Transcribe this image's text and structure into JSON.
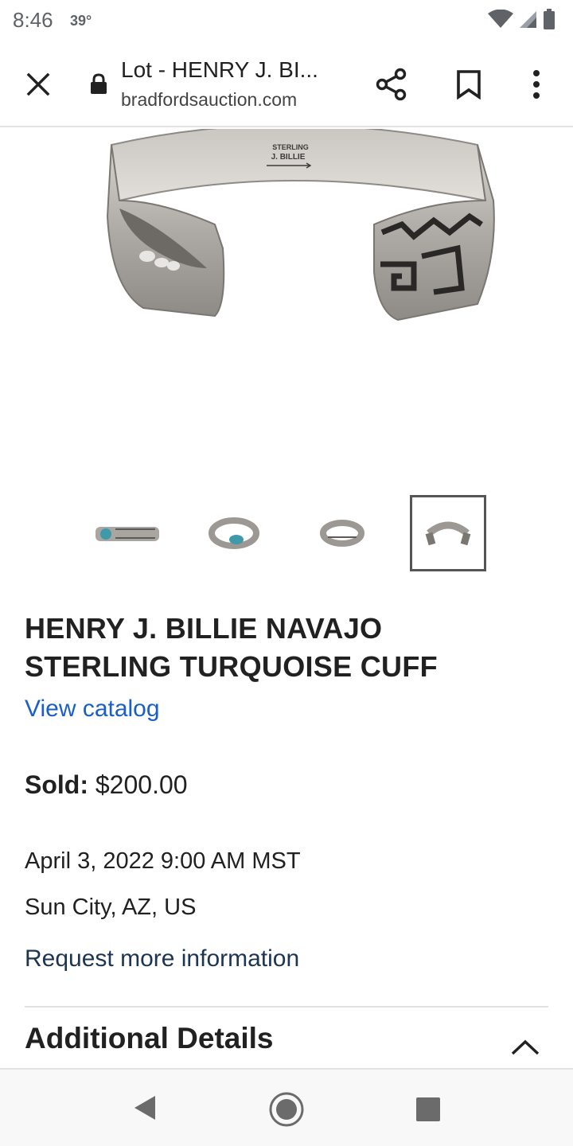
{
  "status_bar": {
    "time": "8:46",
    "temperature": "39°",
    "icons": [
      "wifi-icon",
      "cell-signal-icon",
      "battery-icon"
    ]
  },
  "toolbar": {
    "close_icon": "close-icon",
    "lock_icon": "lock-icon",
    "title": "Lot - HENRY J. BI...",
    "url": "bradfordsauction.com",
    "share_icon": "share-icon",
    "bookmark_icon": "bookmark-icon",
    "menu_icon": "more-vert-icon"
  },
  "gallery": {
    "main_image_stamp_line1": "STERLING",
    "main_image_stamp_line2": "J. BILLIE",
    "thumbnail_count": 4,
    "selected_thumbnail": 4
  },
  "lot": {
    "title": "HENRY J. BILLIE NAVAJO STERLING TURQUOISE CUFF",
    "view_catalog": "View catalog",
    "sold_label": "Sold:",
    "sold_price": "$200.00",
    "date": "April 3, 2022 9:00 AM MST",
    "location": "Sun City, AZ, US",
    "request_info": "Request more information",
    "additional_details": "Additional Details"
  },
  "navbar": {
    "icons": [
      "back-icon",
      "home-icon",
      "recents-icon"
    ]
  },
  "colors": {
    "link": "#1a5ec7",
    "request_link": "#1c3550",
    "text": "#212121",
    "divider": "#e0e0e0"
  }
}
